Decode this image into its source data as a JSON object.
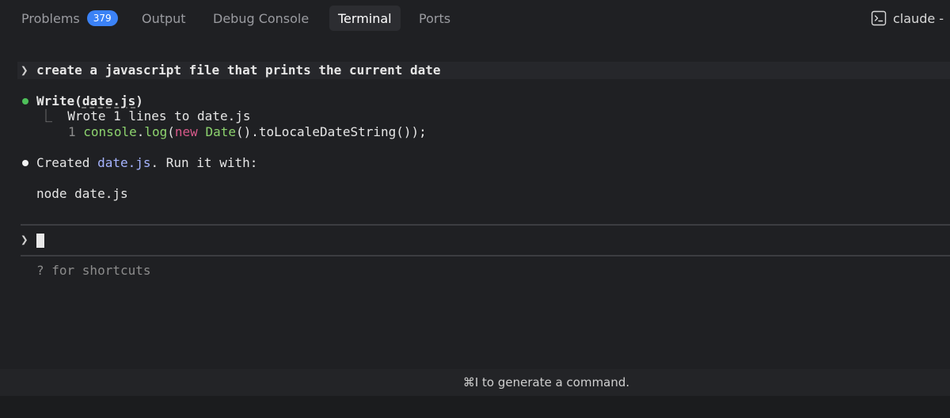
{
  "panel_tabs": {
    "problems": {
      "label": "Problems",
      "count": "379"
    },
    "output": {
      "label": "Output"
    },
    "debug_console": {
      "label": "Debug Console"
    },
    "terminal": {
      "label": "Terminal"
    },
    "ports": {
      "label": "Ports"
    },
    "active": "Terminal"
  },
  "terminal_instance": {
    "icon": "terminal-icon",
    "label": "claude -"
  },
  "session": {
    "prompt_symbol": "❯",
    "user_message": "create a javascript file that prints the current date",
    "tool_call": {
      "name": "Write",
      "arg": "date.js",
      "result_prefix": "⎿",
      "result": "Wrote 1 lines to date.js",
      "code_line_number": "1",
      "code": {
        "object": "console",
        "dot": ".",
        "method": "log",
        "open": "(",
        "keyword": "new",
        "space": " ",
        "class": "Date",
        "rest": "().toLocaleDateString());"
      }
    },
    "response": {
      "prefix": "Created ",
      "file": "date.js",
      "suffix": ". Run it with:",
      "command": "node date.js"
    },
    "input_prompt_symbol": "❯",
    "input_value": "",
    "shortcuts_hint": "? for shortcuts"
  },
  "hint_bar": {
    "text": "⌘I to generate a command."
  },
  "colors": {
    "background": "#1f2023",
    "badge": "#3b82f6",
    "success_dot": "#4ec05a",
    "keyword": "#d7598a",
    "identifier": "#8dd36e",
    "file_link": "#a6b4ff"
  }
}
